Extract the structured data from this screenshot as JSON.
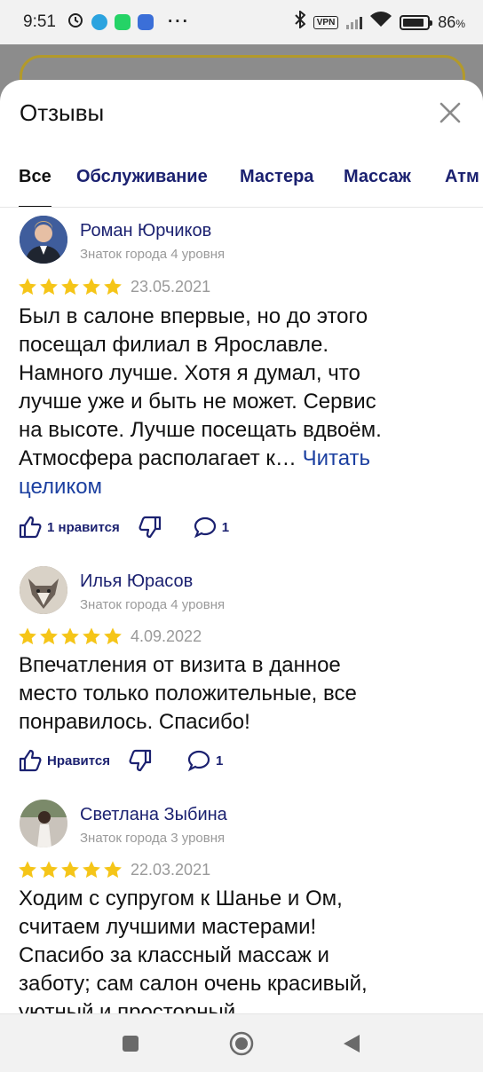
{
  "status_bar": {
    "time": "9:51",
    "vpn": "VPN",
    "battery": "86",
    "battery_unit": "%",
    "battery_level": 0.86
  },
  "sheet": {
    "title": "Отзывы",
    "tabs": [
      {
        "label": "Все",
        "active": true
      },
      {
        "label": "Обслуживание",
        "active": false
      },
      {
        "label": "Мастера",
        "active": false
      },
      {
        "label": "Массаж",
        "active": false
      },
      {
        "label": "Атм",
        "active": false
      }
    ]
  },
  "reviews": [
    {
      "author": "Роман Юрчиков",
      "level": "Знаток города 4 уровня",
      "rating": 5,
      "date": "23.05.2021",
      "lines": [
        "Был в салоне впервые, но до этого",
        "посещал филиал в Ярославле.",
        "Намного лучше. Хотя я думал, что",
        "лучше уже и быть не может. Сервис",
        "на высоте. Лучше посещать вдвоём.",
        "Атмосфера располагает к… "
      ],
      "more_label_1": "Читать",
      "more_label_2": "целиком",
      "likes_label": "1 нравится",
      "comments": "1"
    },
    {
      "author": "Илья Юрасов",
      "level": "Знаток города 4 уровня",
      "rating": 5,
      "date": "4.09.2022",
      "lines": [
        "Впечатления от визита в данное",
        "место только положительные, все",
        "понравилось. Спасибо!"
      ],
      "likes_label": "Нравится",
      "comments": "1"
    },
    {
      "author": "Светлана Зыбина",
      "level": "Знаток города 3 уровня",
      "rating": 5,
      "date": "22.03.2021",
      "lines": [
        "Ходим с супругом к Шанье и Ом,",
        "считаем лучшими мастерами!",
        "Спасибо за классный массаж и",
        "заботу; сам салон очень красивый,",
        "уютный и просторный"
      ]
    }
  ],
  "colors": {
    "accent": "#1b2170",
    "star": "#f5c518",
    "link": "#1b3fa0",
    "muted": "#9a9a9a"
  }
}
